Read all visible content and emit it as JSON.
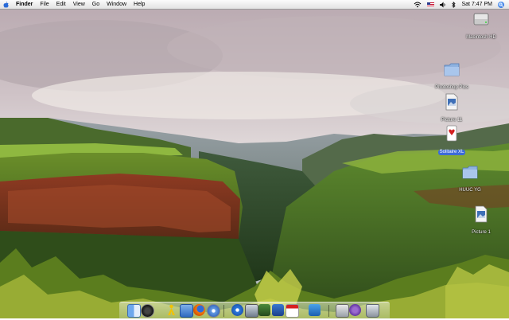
{
  "menubar": {
    "app_name": "Finder",
    "menus": [
      "File",
      "Edit",
      "View",
      "Go",
      "Window",
      "Help"
    ],
    "clock": "Sat 7:47 PM",
    "status_icons": [
      "wifi-icon",
      "flag-icon",
      "speaker-icon",
      "bluetooth-icon",
      "spotlight-icon"
    ]
  },
  "desktop": {
    "icons": [
      {
        "label": "Macintosh HD",
        "icon": "hard-drive-icon",
        "selected": false
      },
      {
        "label": "Photoshop Pics",
        "icon": "folder-icon",
        "selected": false
      },
      {
        "label": "Picture 11",
        "icon": "image-file-icon",
        "selected": false
      },
      {
        "label": "Solitaire XL",
        "icon": "solitaire-app-icon",
        "selected": true
      },
      {
        "label": "HUUC YG",
        "icon": "folder-icon",
        "selected": false
      },
      {
        "label": "Picture 1",
        "icon": "image-file-icon",
        "selected": false
      }
    ]
  },
  "dock": {
    "apps": [
      "finder-icon",
      "dashboard-icon",
      "aim-icon",
      "mail-icon",
      "firefox-icon",
      "safari-icon",
      "itunes-icon",
      "iphoto-icon",
      "imovie-icon",
      "garageband-icon",
      "ical-icon",
      "word-icon",
      "preview-icon",
      "system-preferences-icon",
      "trash-icon"
    ]
  },
  "colors": {
    "selection": "#3d6bd8",
    "menubar": "#eeeeee"
  }
}
